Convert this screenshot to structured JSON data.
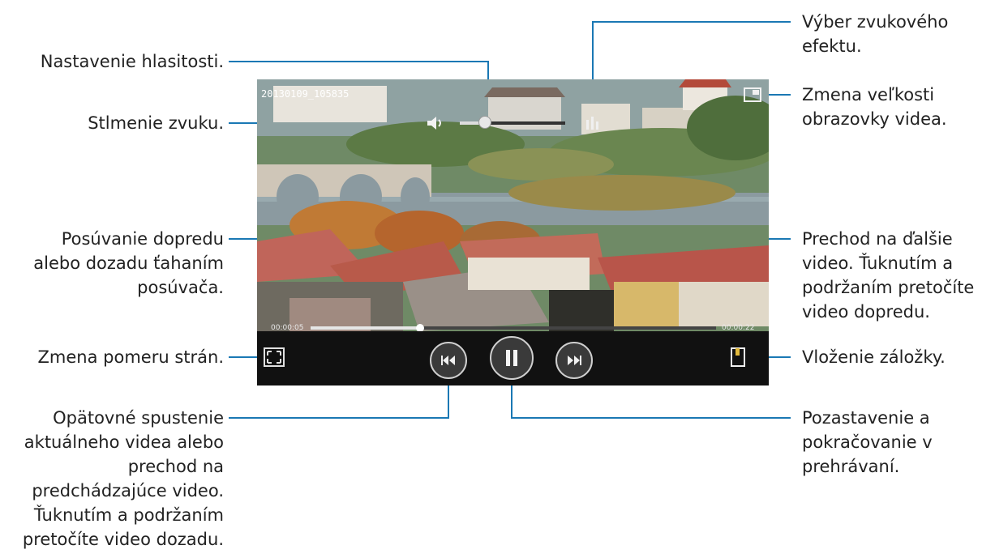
{
  "callouts": {
    "volume": "Nastavenie hlasitosti.",
    "mute": "Stlmenie zvuku.",
    "seek": [
      "Posúvanie dopredu",
      "alebo dozadu ťahaním",
      "posúvača."
    ],
    "aspect": "Zmena pomeru strán.",
    "restart": [
      "Opätovné spustenie",
      "aktuálneho videa alebo",
      "prechod na",
      "predchádzajúce video.",
      "Ťuknutím a podržaním",
      "pretočíte video dozadu."
    ],
    "sound_effect": [
      "Výber zvukového",
      "efektu."
    ],
    "screen_size": [
      "Zmena veľkosti",
      "obrazovky videa."
    ],
    "next": [
      "Prechod na ďalšie",
      "video. Ťuknutím a",
      "podržaním pretočíte",
      "video dopredu."
    ],
    "bookmark": "Vloženie záložky.",
    "pause": [
      "Pozastavenie a",
      "pokračovanie v",
      "prehrávaní."
    ]
  },
  "player": {
    "timestamp": "20130109_105835",
    "elapsed": "00:00:05",
    "total": "00:00:22",
    "progress": 0.27,
    "volume_level": 0.24
  },
  "icons": {
    "mute": "speaker-icon",
    "sound_effect": "equalizer-icon",
    "screen_size": "popup-icon",
    "aspect": "aspect-ratio-icon",
    "prev": "rewind-icon",
    "pause": "pause-icon",
    "next": "fast-forward-icon",
    "bookmark": "bookmark-icon"
  },
  "colors": {
    "callout_line": "#1a78b4",
    "text": "#222222",
    "controls_bg": "#111111"
  }
}
